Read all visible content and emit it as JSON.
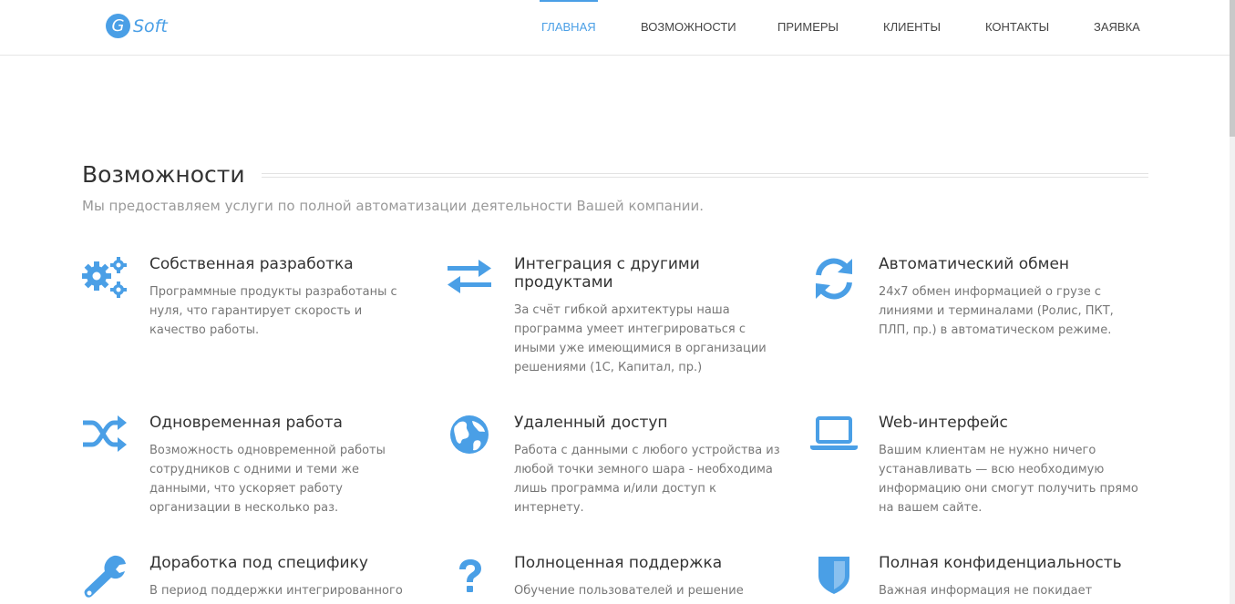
{
  "brand": {
    "letter": "G",
    "name": "Soft",
    "accent": "#4a9fe6"
  },
  "nav": {
    "items": [
      {
        "label": "ГЛАВНАЯ",
        "active": true
      },
      {
        "label": "ВОЗМОЖНОСТИ",
        "active": false
      },
      {
        "label": "ПРИМЕРЫ",
        "active": false
      },
      {
        "label": "КЛИЕНТЫ",
        "active": false
      },
      {
        "label": "КОНТАКТЫ",
        "active": false
      },
      {
        "label": "ЗАЯВКА",
        "active": false
      }
    ]
  },
  "section": {
    "title": "Возможности",
    "subtitle": "Мы предоставляем услуги по полной автоматизации деятельности Вашей компании."
  },
  "features": [
    {
      "icon": "gears-icon",
      "title": "Собственная разработка",
      "desc": "Программные продукты разработаны с нуля, что гарантирует скорость и качество работы."
    },
    {
      "icon": "exchange-arrows-icon",
      "title": "Интеграция с другими продуктами",
      "desc": "За счёт гибкой архитектуры наша программа умеет интегрироваться с иными уже имеющимися в организации решениями (1С, Капитал, пр.)"
    },
    {
      "icon": "refresh-icon",
      "title": "Автоматический обмен",
      "desc": "24x7 обмен информацией о грузе с линиями и терминалами (Ролис, ПКТ, ПЛП, пр.) в автоматическом режиме."
    },
    {
      "icon": "shuffle-icon",
      "title": "Одновременная работа",
      "desc": "Возможность одновременной работы сотрудников с одними и теми же данными, что ускоряет работу организации в несколько раз."
    },
    {
      "icon": "globe-icon",
      "title": "Удаленный доступ",
      "desc": "Работа с данными с любого устройства из любой точки земного шара - необходима лишь программа и/или доступ к интернету."
    },
    {
      "icon": "laptop-icon",
      "title": "Web-интерфейс",
      "desc": "Вашим клиентам не нужно ничего устанавливать — всю необходимую информацию они смогут получить прямо на вашем сайте."
    },
    {
      "icon": "wrench-icon",
      "title": "Доработка под специфику",
      "desc": "В период поддержки интегрированного"
    },
    {
      "icon": "question-icon",
      "title": "Полноценная поддержка",
      "desc": "Обучение пользователей и решение"
    },
    {
      "icon": "shield-icon",
      "title": "Полная конфиденциальность",
      "desc": "Важная информация не покидает"
    }
  ]
}
